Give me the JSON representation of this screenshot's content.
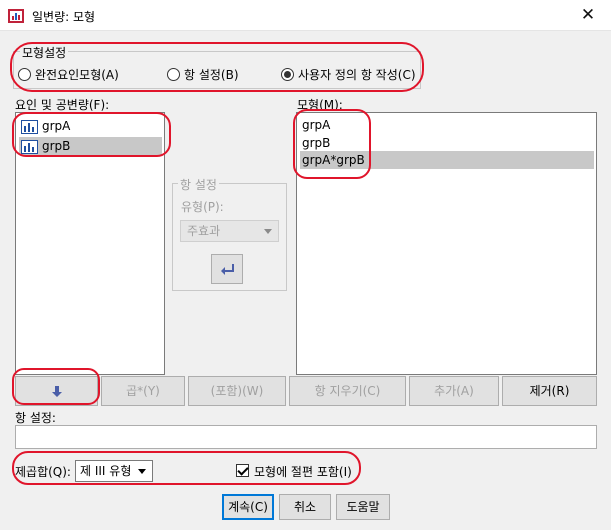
{
  "window": {
    "title": "일변량: 모형",
    "close_glyph": "✕"
  },
  "model_spec": {
    "group_title": "모형설정",
    "options": [
      {
        "label": "완전요인모형(A)",
        "selected": false
      },
      {
        "label": "항 설정(B)",
        "selected": false
      },
      {
        "label": "사용자 정의 항 작성(C)",
        "selected": true
      }
    ]
  },
  "factors": {
    "label": "요인 및 공변량(F):",
    "items": [
      "grpA",
      "grpB"
    ],
    "selected_index": 1
  },
  "model": {
    "label": "모형(M):",
    "items": [
      "grpA",
      "grpB",
      "grpA*grpB"
    ],
    "selected_index": 2
  },
  "build_term": {
    "group_title": "항 설정",
    "type_label": "유형(P):",
    "type_value": "주효과",
    "arrow_icon": "move-arrow-icon"
  },
  "term_buttons": {
    "move_icon": "down-arrow-icon",
    "multiply": "곱*(Y)",
    "nest": "(포함)(W)",
    "clear": "항 지우기(C)",
    "add": "추가(A)",
    "remove": "제거(R)"
  },
  "term_field": {
    "label": "항 설정:",
    "value": ""
  },
  "sum_of_squares": {
    "label": "제곱합(Q):",
    "value": "제 III 유형"
  },
  "intercept": {
    "label": "모형에 절편 포함(I)",
    "checked": true
  },
  "footer": {
    "continue": "계속(C)",
    "cancel": "취소",
    "help": "도움말"
  },
  "colors": {
    "annotation": "#e0152b",
    "selection": "#c8c8c8",
    "focus_border": "#0078d7"
  }
}
